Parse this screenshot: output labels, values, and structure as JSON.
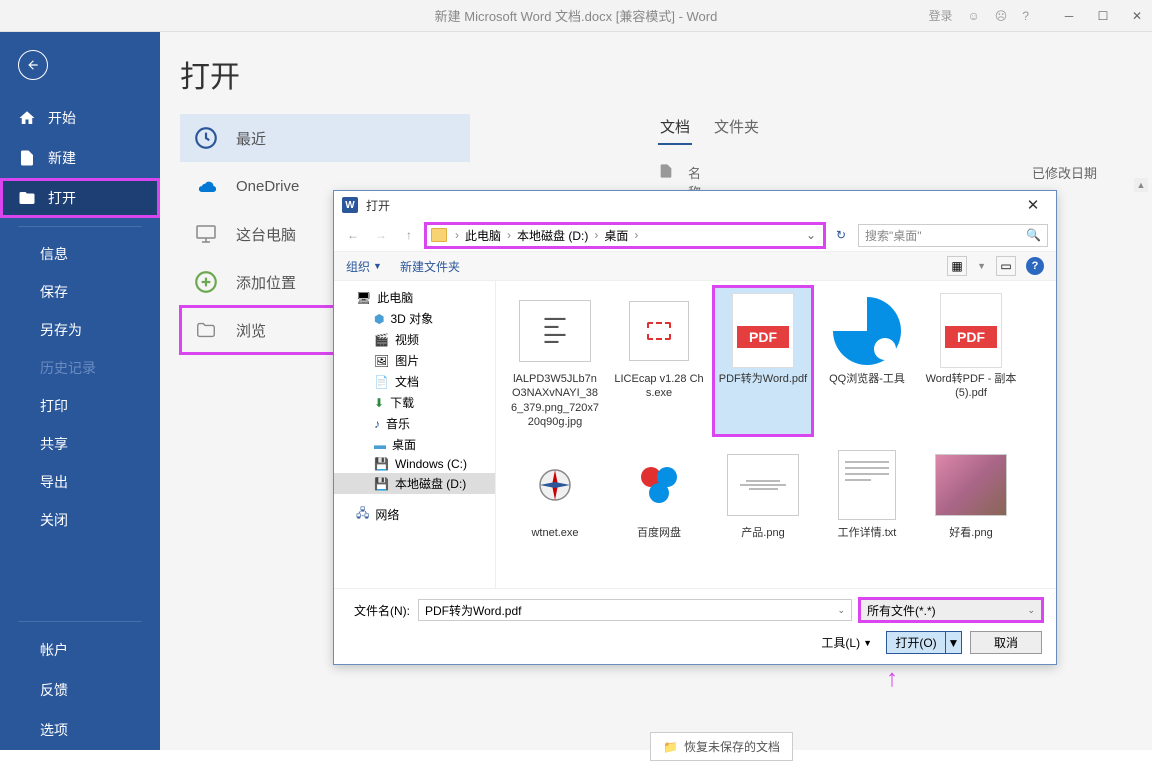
{
  "titlebar": {
    "title": "新建 Microsoft Word 文档.docx [兼容模式] - Word",
    "login": "登录"
  },
  "sidebar": {
    "start": "开始",
    "new": "新建",
    "open": "打开",
    "info": "信息",
    "save": "保存",
    "saveas": "另存为",
    "history": "历史记录",
    "print": "打印",
    "share": "共享",
    "export": "导出",
    "close": "关闭",
    "account": "帐户",
    "feedback": "反馈",
    "options": "选项"
  },
  "page": {
    "title": "打开"
  },
  "locations": {
    "recent": "最近",
    "onedrive": "OneDrive",
    "thispc": "这台电脑",
    "addplace": "添加位置",
    "browse": "浏览"
  },
  "doc_panel": {
    "tab_docs": "文档",
    "tab_folders": "文件夹",
    "col_name": "名称",
    "col_date": "已修改日期"
  },
  "recover_btn": "恢复未保存的文档",
  "dialog": {
    "title": "打开",
    "breadcrumb": [
      "此电脑",
      "本地磁盘 (D:)",
      "桌面"
    ],
    "search_placeholder": "搜索\"桌面\"",
    "organize": "组织",
    "newfolder": "新建文件夹",
    "tree": {
      "thispc": "此电脑",
      "objects3d": "3D 对象",
      "videos": "视频",
      "pictures": "图片",
      "documents": "文档",
      "downloads": "下载",
      "music": "音乐",
      "desktop": "桌面",
      "windowsc": "Windows (C:)",
      "locald": "本地磁盘 (D:)",
      "network": "网络"
    },
    "files": [
      {
        "name": "lALPD3W5JLb7nO3NAXvNAYI_386_379.png_720x720q90g.jpg",
        "type": "img"
      },
      {
        "name": "LICEcap v1.28 Chs.exe",
        "type": "exe"
      },
      {
        "name": "PDF转为Word.pdf",
        "type": "pdf",
        "selected": true
      },
      {
        "name": "QQ浏览器-工具",
        "type": "qq"
      },
      {
        "name": "Word转PDF - 副本 (5).pdf",
        "type": "pdf"
      },
      {
        "name": "wtnet.exe",
        "type": "exe2"
      },
      {
        "name": "百度网盘",
        "type": "baidu"
      },
      {
        "name": "产品.png",
        "type": "png"
      },
      {
        "name": "工作详情.txt",
        "type": "txt"
      },
      {
        "name": "好看.png",
        "type": "photo"
      }
    ],
    "filename_label": "文件名(N):",
    "filename_value": "PDF转为Word.pdf",
    "filetype": "所有文件(*.*)",
    "tools": "工具(L)",
    "open_btn": "打开(O)",
    "cancel_btn": "取消"
  }
}
